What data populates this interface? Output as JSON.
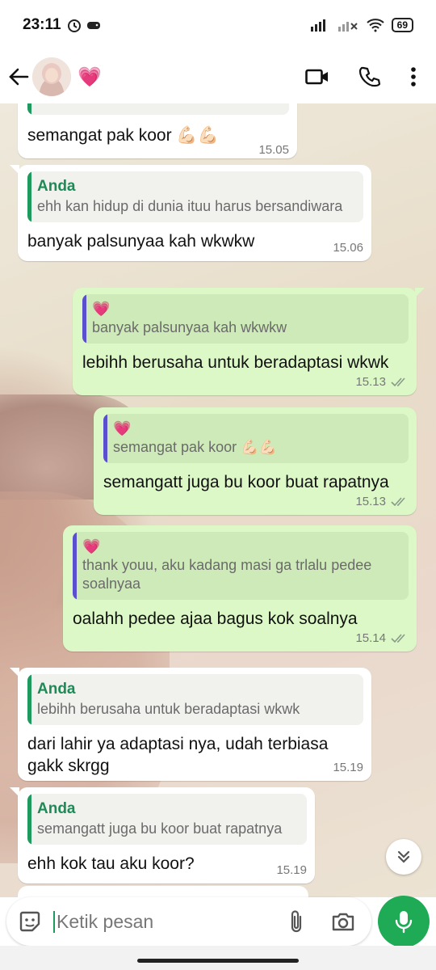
{
  "status_bar": {
    "time": "23:11",
    "battery": "69"
  },
  "contact": {
    "name": "💗"
  },
  "messages": [
    {
      "id": "m1",
      "direction": "in",
      "text": "semangat pak koor 💪🏻💪🏻",
      "time": "15.05"
    },
    {
      "id": "m2",
      "direction": "in",
      "quote_author": "Anda",
      "quote_text": "ehh kan hidup di dunia ituu harus bersandiwara",
      "text": "banyak palsunyaa kah wkwkw",
      "time": "15.06"
    },
    {
      "id": "m3",
      "direction": "out",
      "quote_author": "💗",
      "quote_text": "banyak palsunyaa kah wkwkw",
      "text": "lebihh berusaha untuk beradaptasi wkwk",
      "time": "15.13"
    },
    {
      "id": "m4",
      "direction": "out",
      "quote_author": "💗",
      "quote_text": "semangat pak koor 💪🏻💪🏻",
      "text": "semangatt juga bu koor buat rapatnya",
      "time": "15.13"
    },
    {
      "id": "m5",
      "direction": "out",
      "quote_author": "💗",
      "quote_text": "thank youu, aku kadang masi ga trlalu pedee soalnyaa",
      "text": "oalahh pedee ajaa bagus kok soalnya",
      "time": "15.14"
    },
    {
      "id": "m6",
      "direction": "in",
      "quote_author": "Anda",
      "quote_text": "lebihh berusaha untuk beradaptasi wkwk",
      "text": "dari lahir ya adaptasi nya, udah terbiasa gakk skrgg",
      "time": "15.19"
    },
    {
      "id": "m7",
      "direction": "in",
      "quote_author": "Anda",
      "quote_text": "semangatt juga bu koor buat rapatnya",
      "text": "ehh kok tau aku koor?",
      "time": "15.19"
    }
  ],
  "input": {
    "placeholder": "Ketik pesan"
  },
  "icons": {
    "back": "arrow-left-icon",
    "video": "video-call-icon",
    "call": "phone-icon",
    "menu": "more-vert-icon",
    "sticker": "sticker-icon",
    "attach": "paperclip-icon",
    "camera": "camera-icon",
    "mic": "mic-icon",
    "scroll_down": "double-chevron-down-icon",
    "read_receipt": "double-check-icon"
  },
  "colors": {
    "accent": "#1faa55",
    "outgoing_bubble": "#dbf8c6",
    "incoming_bubble": "#ffffff",
    "quote_author": "#1f8a57",
    "quote_bar_contact": "#5a4fcf"
  }
}
